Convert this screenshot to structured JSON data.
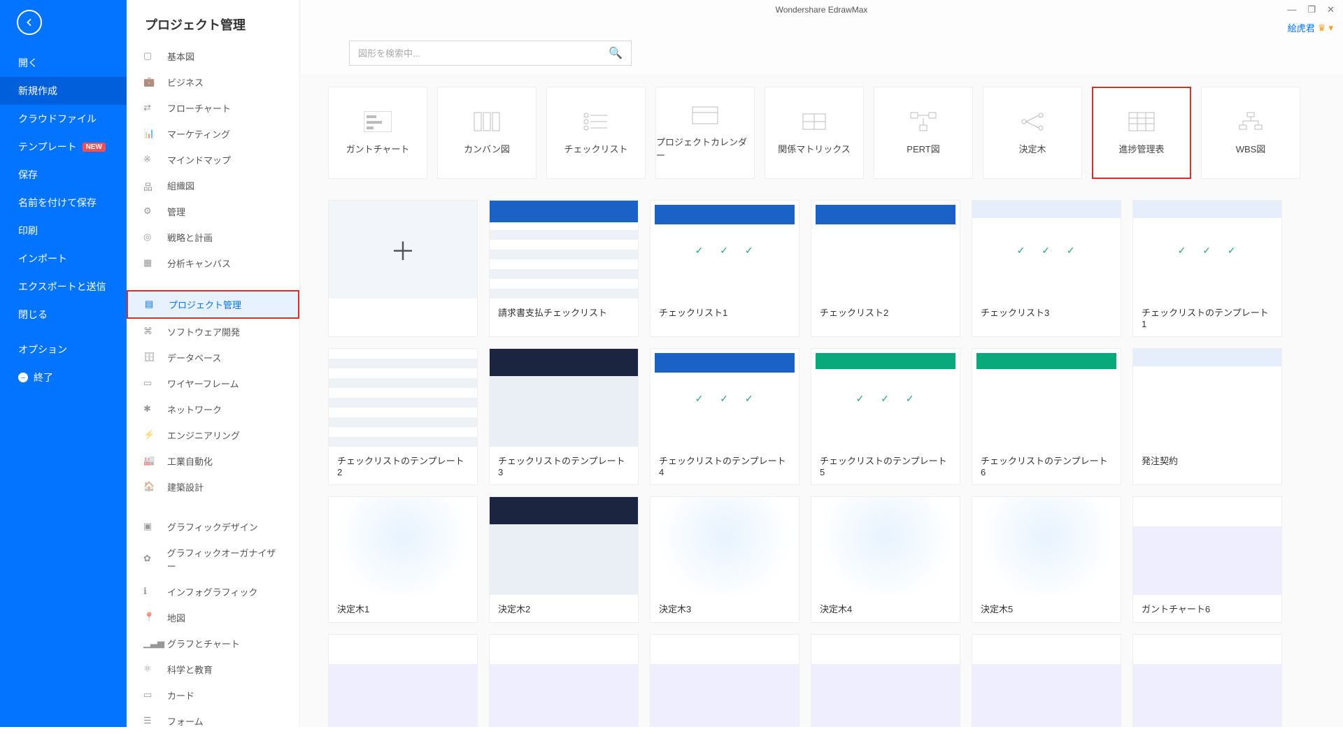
{
  "app": {
    "title": "Wondershare EdrawMax",
    "user": "絵虎君"
  },
  "win": {
    "min": "—",
    "max": "❐",
    "close": "✕"
  },
  "leftnav": {
    "open": "開く",
    "new": "新規作成",
    "cloud": "クラウドファイル",
    "template": "テンプレート",
    "template_badge": "NEW",
    "save": "保存",
    "saveas": "名前を付けて保存",
    "print": "印刷",
    "import": "インポート",
    "export": "エクスポートと送信",
    "close": "閉じる",
    "option": "オプション",
    "exit": "終了"
  },
  "cat": {
    "title": "プロジェクト管理",
    "items": [
      "基本図",
      "ビジネス",
      "フローチャート",
      "マーケティング",
      "マインドマップ",
      "組織図",
      "管理",
      "戦略と計画",
      "分析キャンバス",
      "プロジェクト管理",
      "ソフトウェア開発",
      "データベース",
      "ワイヤーフレーム",
      "ネットワーク",
      "エンジニアリング",
      "工業自動化",
      "建築設計",
      "グラフィックデザイン",
      "グラフィックオーガナイザー",
      "インフォグラフィック",
      "地図",
      "グラフとチャート",
      "科学と教育",
      "カード",
      "フォーム"
    ]
  },
  "search": {
    "placeholder": "図形を検索中..."
  },
  "subtypes": [
    "ガントチャート",
    "カンバン図",
    "チェックリスト",
    "プロジェクトカレンダー",
    "関係マトリックス",
    "PERT図",
    "決定木",
    "進捗管理表",
    "WBS図"
  ],
  "templates": {
    "r1": [
      "",
      "請求書支払チェックリスト",
      "チェックリスト1",
      "チェックリスト2",
      "チェックリスト3",
      "チェックリストのテンプレート1"
    ],
    "r2": [
      "チェックリストのテンプレート2",
      "チェックリストのテンプレート3",
      "チェックリストのテンプレート4",
      "チェックリストのテンプレート5",
      "チェックリストのテンプレート6",
      "発注契約"
    ],
    "r3": [
      "決定木1",
      "決定木2",
      "決定木3",
      "決定木4",
      "決定木5",
      "ガントチャート6"
    ]
  }
}
